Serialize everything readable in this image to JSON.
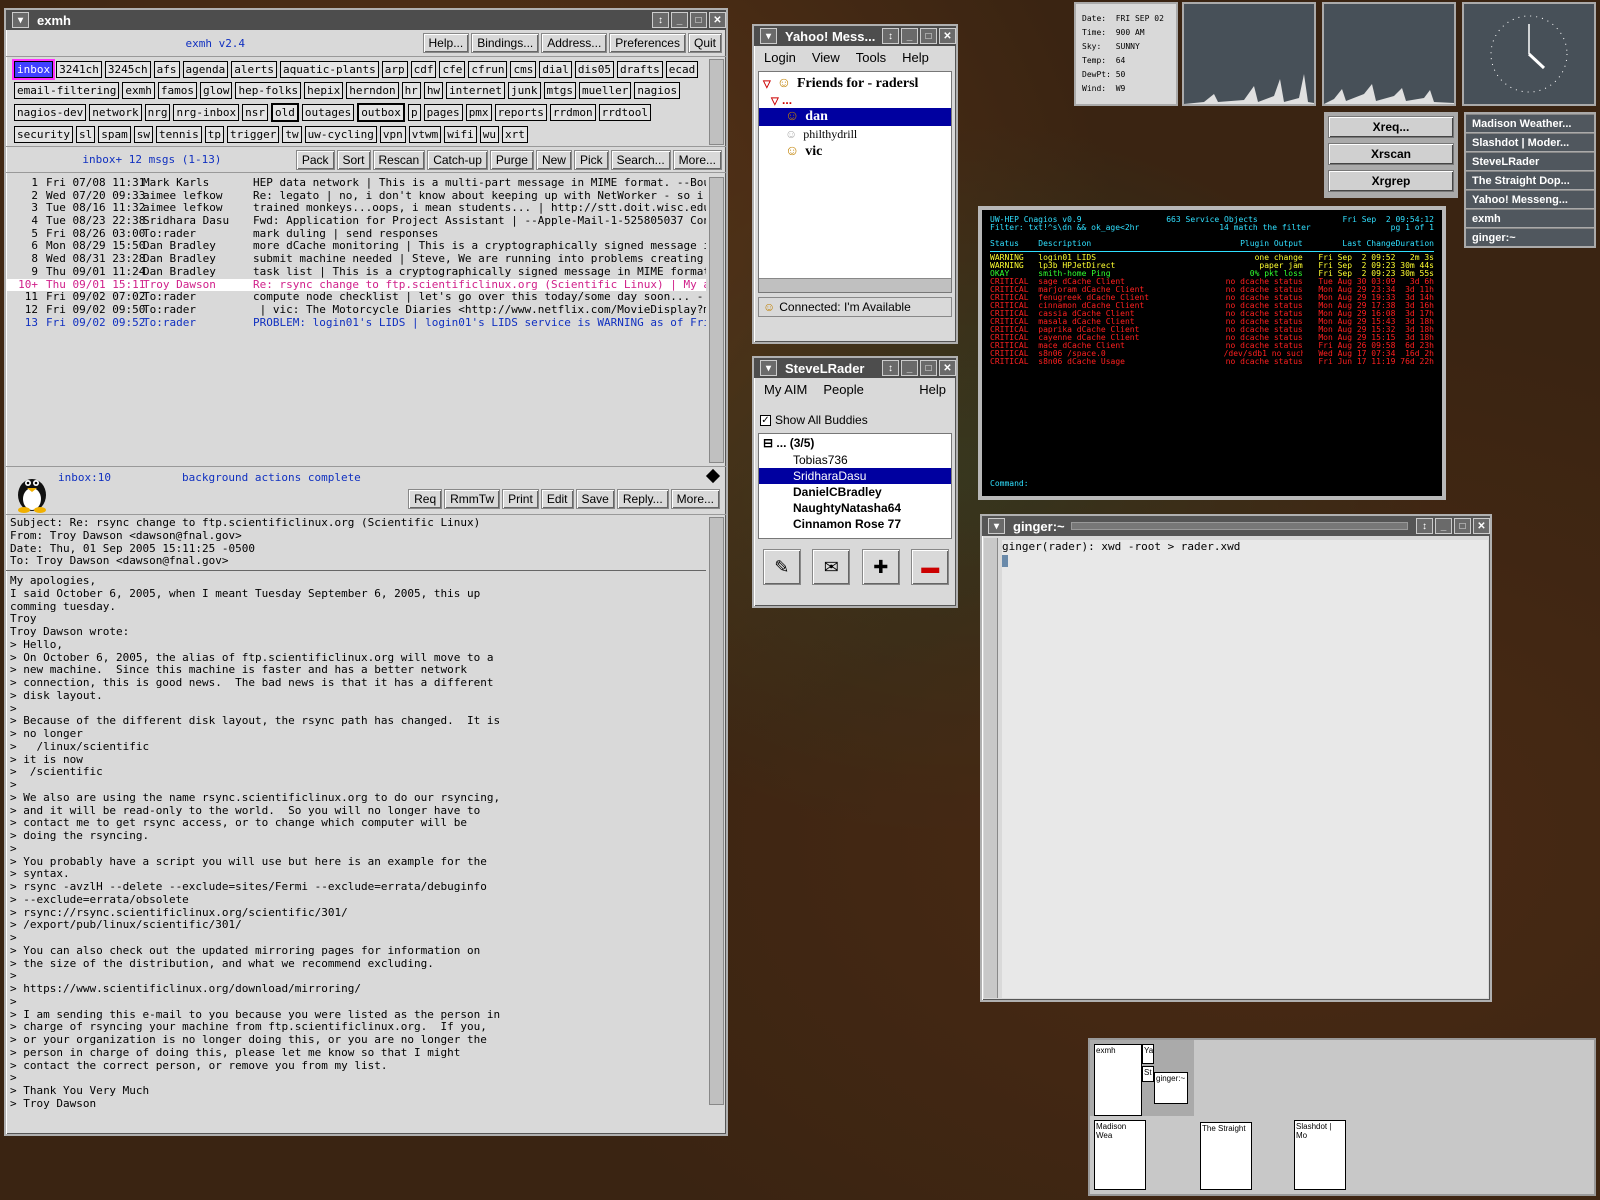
{
  "exmh": {
    "title": "exmh",
    "version": "exmh v2.4",
    "top_buttons": [
      "Help...",
      "Bindings...",
      "Address...",
      "Preferences",
      "Quit"
    ],
    "folders": [
      "inbox",
      "3241ch",
      "3245ch",
      "afs",
      "agenda",
      "alerts",
      "aquatic-plants",
      "arp",
      "cdf",
      "cfe",
      "cfrun",
      "cms",
      "dial",
      "dis05",
      "drafts",
      "ecad",
      "email-filtering",
      "exmh",
      "famos",
      "glow",
      "hep-folks",
      "hepix",
      "herndon",
      "hr",
      "hw",
      "internet",
      "junk",
      "mtgs",
      "mueller",
      "nagios",
      "nagios-dev",
      "network",
      "nrg",
      "nrg-inbox",
      "nsr",
      "old",
      "outages",
      "outbox",
      "p",
      "pages",
      "pmx",
      "reports",
      "rrdmon",
      "rrdtool",
      "security",
      "sl",
      "spam",
      "sw",
      "tennis",
      "tp",
      "trigger",
      "tw",
      "uw-cycling",
      "vpn",
      "vtwm",
      "wifi",
      "wu",
      "xrt"
    ],
    "summary": "inbox+ 12 msgs (1-13)",
    "folder_buttons": [
      "Pack",
      "Sort",
      "Rescan",
      "Catch-up",
      "Purge",
      "New",
      "Pick",
      "Search...",
      "More..."
    ],
    "messages": [
      {
        "n": "1",
        "date": "Fri 07/08 11:31",
        "from": "Mark Karls",
        "subject": "HEP data network | This is a multi-part message in MIME format. --Boundary_"
      },
      {
        "n": "2",
        "date": "Wed 07/20 09:33",
        "from": "aimee lefkow",
        "subject": "Re: legato | no, i don't know about keeping up with NetWorker - so i guess"
      },
      {
        "n": "3",
        "date": "Tue 08/16 11:32",
        "from": "aimee lefkow",
        "subject": "trained monkeys...oops, i mean students... | http://stt.doit.wisc.edu/ http"
      },
      {
        "n": "4",
        "date": "Tue 08/23 22:38",
        "from": "Sridhara Dasu",
        "subject": "Fwd: Application for Project Assistant | --Apple-Mail-1-525805037 Content-T"
      },
      {
        "n": "5",
        "date": "Fri 08/26 03:00",
        "from": "To:rader",
        "subject": "mark duling | send responses"
      },
      {
        "n": "6",
        "date": "Mon 08/29 15:50",
        "from": "Dan Bradley",
        "subject": "more dCache monitoring | This is a cryptographically signed message in MIME"
      },
      {
        "n": "8",
        "date": "Wed 08/31 23:28",
        "from": "Dan Bradley",
        "subject": "submit machine needed | Steve, We are running into problems creating new as"
      },
      {
        "n": "9",
        "date": "Thu 09/01 11:24",
        "from": "Dan Bradley",
        "subject": "task list | This is a cryptographically signed message in MIME format. ----"
      },
      {
        "n": "10+",
        "date": "Thu 09/01 15:11",
        "from": "Troy Dawson",
        "subject": "Re: rsync change to ftp.scientificlinux.org (Scientific Linux) | My apologi"
      },
      {
        "n": "11",
        "date": "Fri 09/02 07:02",
        "from": "To:rader",
        "subject": "compute node checklist | let's go over this today/some day soon... - check"
      },
      {
        "n": "12",
        "date": "Fri 09/02 09:50",
        "from": "To:rader",
        "subject": " | vic: The Motorcycle Diaries <http://www.netflix.com/MovieDisplay?movieic"
      },
      {
        "n": "13",
        "date": "Fri 09/02 09:52",
        "from": "To:rader",
        "subject": "PROBLEM: login01's LIDS | login01's LIDS service is WARNING as of Fri Sep C"
      }
    ],
    "msg_info": "inbox:10",
    "status": "background actions complete",
    "msg_buttons": [
      "Req",
      "RmmTw",
      "Print",
      "Edit",
      "Save",
      "Reply...",
      "More..."
    ],
    "headers": "Subject: Re: rsync change to ftp.scientificlinux.org (Scientific Linux)\nFrom: Troy Dawson <dawson@fnal.gov>\nDate: Thu, 01 Sep 2005 15:11:25 -0500\nTo: Troy Dawson <dawson@fnal.gov>",
    "body": "My apologies,\nI said October 6, 2005, when I meant Tuesday September 6, 2005, this up\ncomming tuesday.\nTroy\nTroy Dawson wrote:\n> Hello,\n> On October 6, 2005, the alias of ftp.scientificlinux.org will move to a\n> new machine.  Since this machine is faster and has a better network\n> connection, this is good news.  The bad news is that it has a different\n> disk layout.\n>\n> Because of the different disk layout, the rsync path has changed.  It is\n> no longer\n>   /linux/scientific\n> it is now\n>  /scientific\n>\n> We also are using the name rsync.scientificlinux.org to do our rsyncing,\n> and it will be read-only to the world.  So you will no longer have to\n> contact me to get rsync access, or to change which computer will be\n> doing the rsyncing.\n>\n> You probably have a script you will use but here is an example for the\n> syntax.\n> rsync -avzlH --delete --exclude=sites/Fermi --exclude=errata/debuginfo\n> --exclude=errata/obsolete\n> rsync://rsync.scientificlinux.org/scientific/301/\n> /export/pub/linux/scientific/301/\n>\n> You can also check out the updated mirroring pages for information on\n> the size of the distribution, and what we recommend excluding.\n>\n> https://www.scientificlinux.org/download/mirroring/\n>\n> I am sending this e-mail to you because you were listed as the person in\n> charge of rsyncing your machine from ftp.scientificlinux.org.  If you,\n> or your organization is no longer doing this, or you are no longer the\n> person in charge of doing this, please let me know so that I might\n> contact the correct person, or remove you from my list.\n>\n> Thank You Very Much\n> Troy Dawson"
  },
  "yahoo": {
    "title": "Yahoo! Mess...",
    "menus": [
      "Login",
      "View",
      "Tools",
      "Help"
    ],
    "group": "Friends for - radersl",
    "ellipsis": "...",
    "friends": [
      "dan",
      "philthydrill",
      "vic"
    ],
    "status": "Connected: I'm Available"
  },
  "aim": {
    "title": "SteveLRader",
    "menus": [
      "My AIM",
      "People",
      "Help"
    ],
    "show_all": "Show All Buddies",
    "group": "... (3/5)",
    "buddies": [
      "Tobias736",
      "SridharaDasu",
      "DanielCBradley",
      "NaughtyNatasha64",
      "Cinnamon Rose 77"
    ]
  },
  "weather": {
    "lines": [
      "Date:  FRI SEP 02",
      "Time:  900 AM",
      "Sky:   SUNNY",
      "Temp:  64",
      "DewPt: 50",
      "Wind:  W9"
    ]
  },
  "launchers": [
    "Xreq...",
    "Xrscan",
    "Xrgrep"
  ],
  "tasklist": [
    "Madison Weather...",
    "Slashdot | Moder...",
    "SteveLRader",
    "The Straight Dop...",
    "Yahoo! Messeng...",
    "exmh",
    "ginger:~"
  ],
  "nagios": {
    "header1": "UW-HEP Cnagios v0.9",
    "header2": "663 Service Objects",
    "header3": "Fri Sep  2 09:54:12",
    "filter": "Filter: txt!^s\\dn && ok_age<2hr",
    "match": "14 match the filter",
    "page": "pg 1 of 1",
    "cols": [
      "Status",
      "Description",
      "Plugin Output",
      "Last Change",
      "Duration"
    ],
    "rows": [
      [
        "WARNING",
        "login01 LIDS",
        "one change",
        "Fri Sep  2 09:52",
        "2m 3s"
      ],
      [
        "WARNING",
        "lp3b HPJetDirect",
        "paper jam",
        "Fri Sep  2 09:23",
        "30m 44s"
      ],
      [
        "OKAY",
        "smith-home Ping",
        "0% pkt loss",
        "Fri Sep  2 09:23",
        "30m 55s"
      ],
      [
        "CRITICAL",
        "sage dCache Client",
        "no dcache status",
        "Tue Aug 30 03:09",
        "3d 6h"
      ],
      [
        "CRITICAL",
        "marjoram dCache Client",
        "no dcache status",
        "Mon Aug 29 23:34",
        "3d 11h"
      ],
      [
        "CRITICAL",
        "fenugreek dCache Client",
        "no dcache status",
        "Mon Aug 29 19:33",
        "3d 14h"
      ],
      [
        "CRITICAL",
        "cinnamon dCache Client",
        "no dcache status",
        "Mon Aug 29 17:38",
        "3d 16h"
      ],
      [
        "CRITICAL",
        "cassia dCache Client",
        "no dcache status",
        "Mon Aug 29 16:08",
        "3d 17h"
      ],
      [
        "CRITICAL",
        "masala dCache Client",
        "no dcache status",
        "Mon Aug 29 15:43",
        "3d 18h"
      ],
      [
        "CRITICAL",
        "paprika dCache Client",
        "no dcache status",
        "Mon Aug 29 15:32",
        "3d 18h"
      ],
      [
        "CRITICAL",
        "cayenne dCache Client",
        "no dcache status",
        "Mon Aug 29 15:15",
        "3d 18h"
      ],
      [
        "CRITICAL",
        "mace dCache Client",
        "no dcache status",
        "Fri Aug 26 09:58",
        "6d 23h"
      ],
      [
        "CRITICAL",
        "s8n06 /space.0",
        "/dev/sdb1 no such file",
        "Wed Aug 17 07:34",
        "16d 2h"
      ],
      [
        "CRITICAL",
        "s8n06 dCache Usage",
        "no dcache status",
        "Fri Jun 17 11:19",
        "76d 22h"
      ]
    ],
    "command": "Command:"
  },
  "terminal": {
    "title": "ginger:~",
    "line": "ginger(rader): xwd -root > rader.xwd"
  },
  "pager": {
    "labels": [
      "exmh",
      "Ya",
      "St",
      "ginger:~",
      "Madison Wea",
      "The Straight",
      "Slashdot | Mo"
    ]
  },
  "colors": {
    "titlebar": "#4d4d4d",
    "selection": "#0000a0",
    "nagios_crit": "#ff2020",
    "nagios_warn": "#ffff30",
    "nagios_ok": "#30ff30",
    "nagios_head": "#30e0ff"
  }
}
